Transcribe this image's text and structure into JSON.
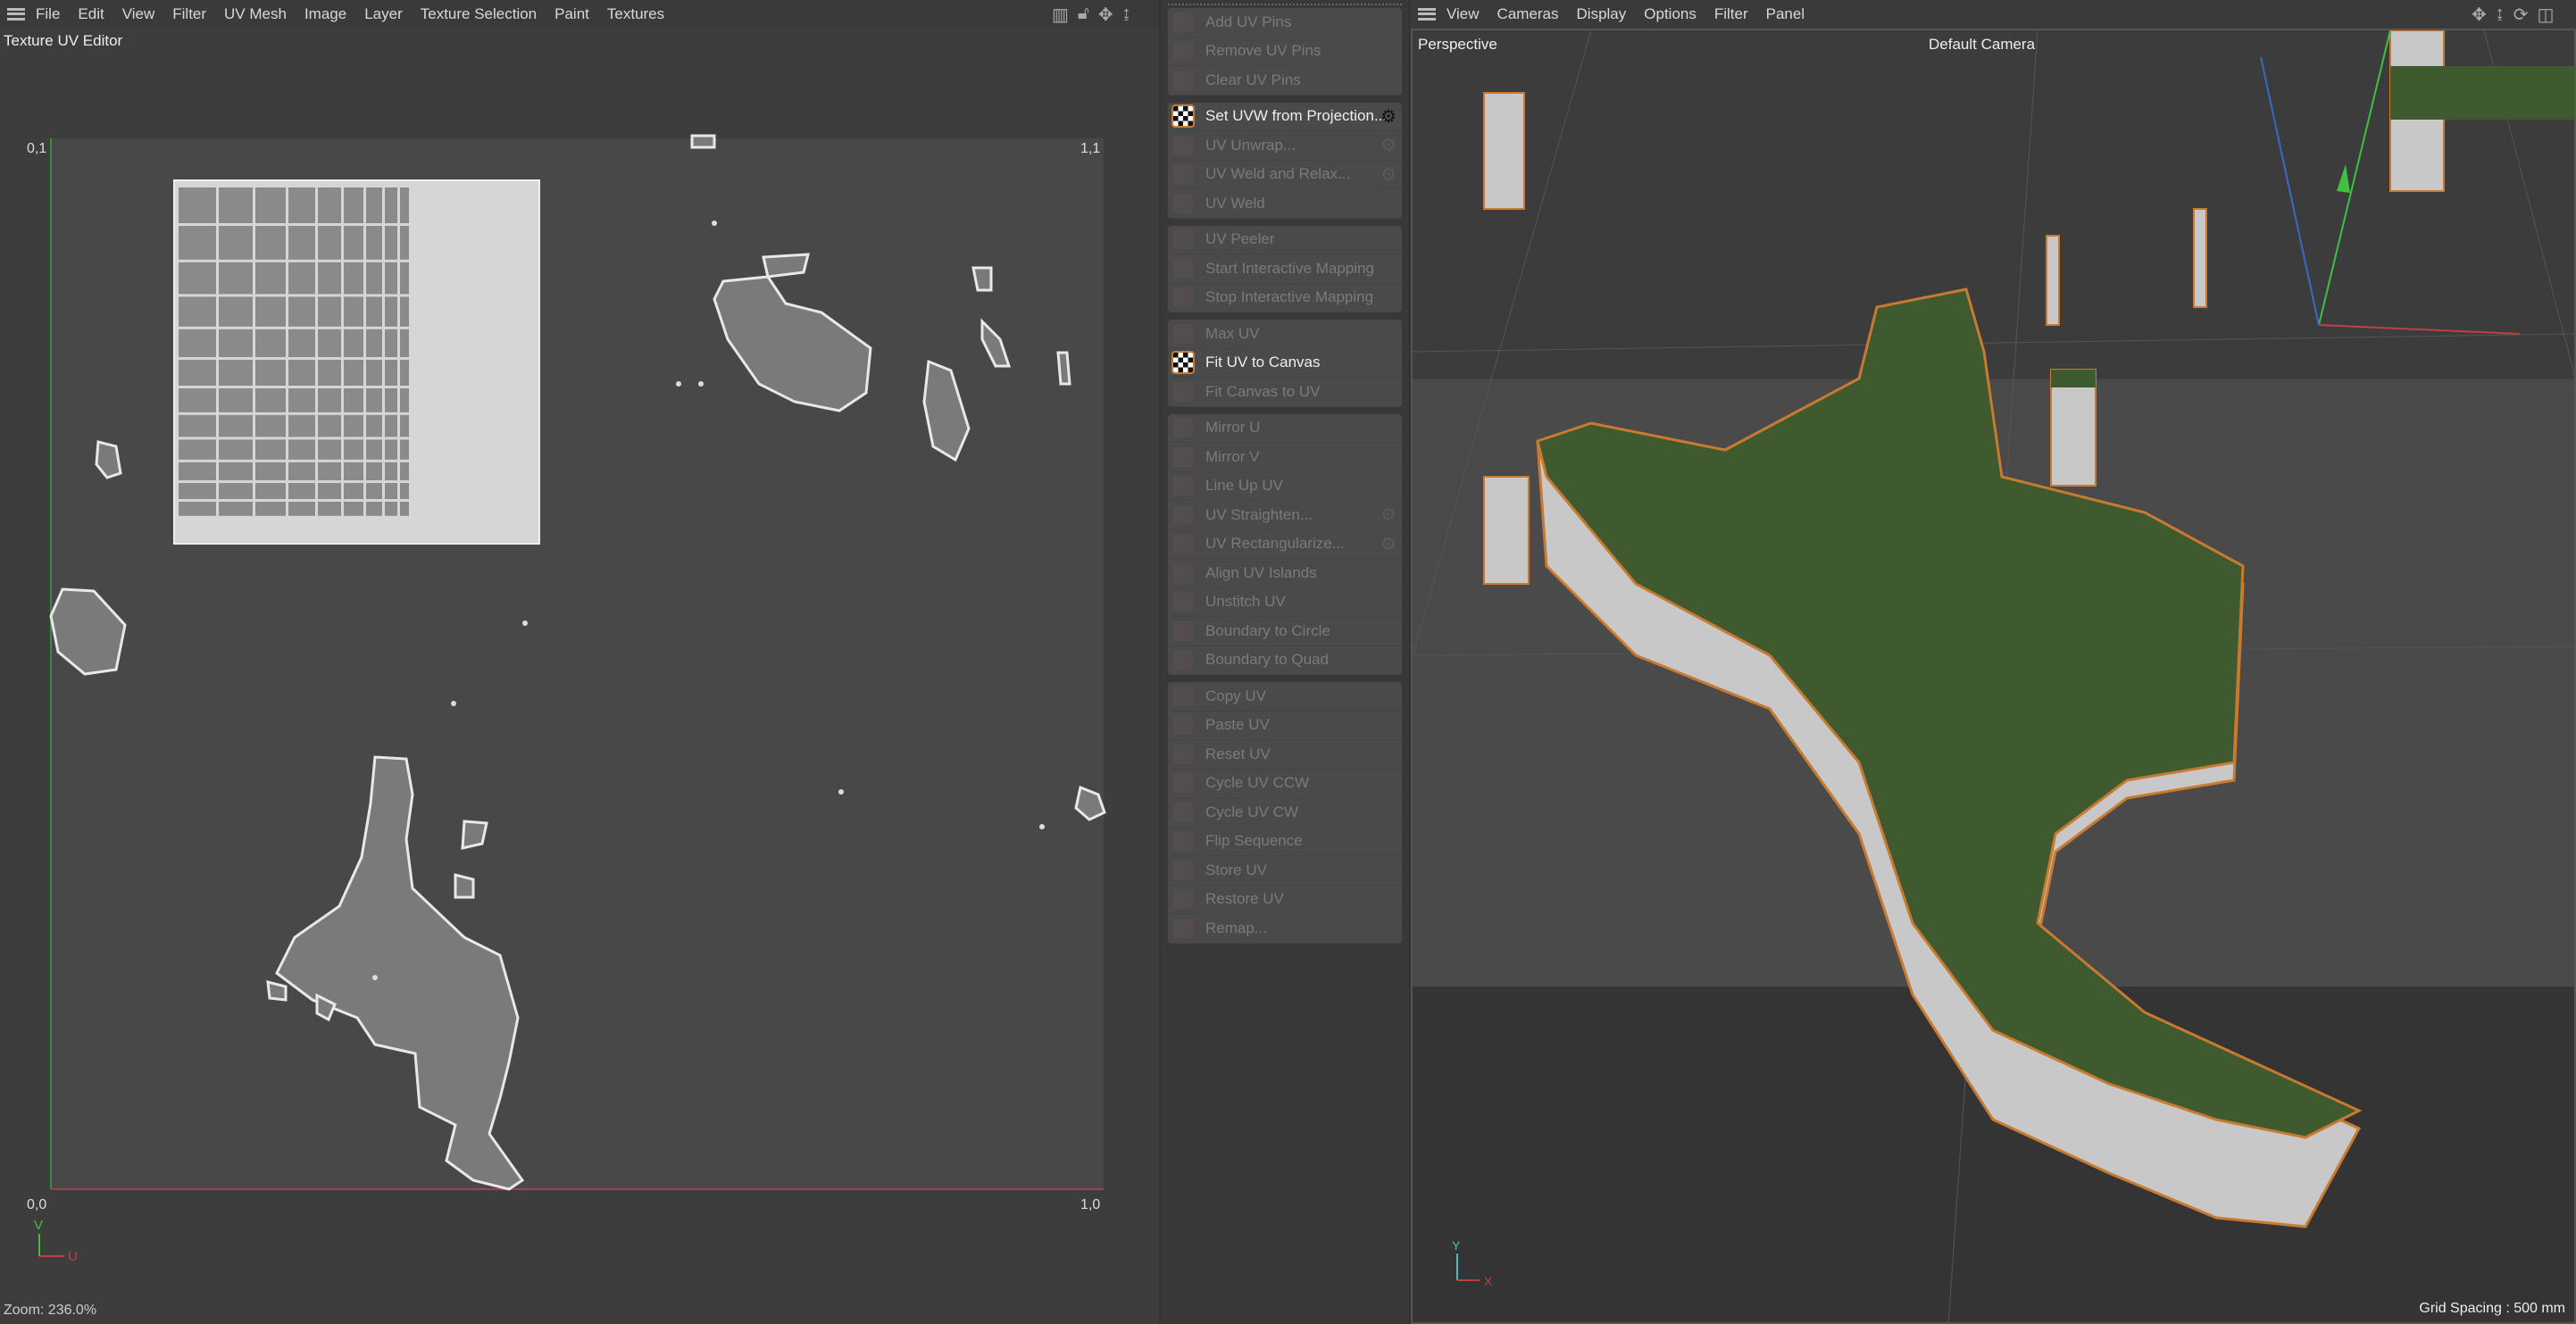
{
  "uv_editor": {
    "menu": [
      "File",
      "Edit",
      "View",
      "Filter",
      "UV Mesh",
      "Image",
      "Layer",
      "Texture Selection",
      "Paint",
      "Textures"
    ],
    "title": "Texture UV Editor",
    "corner_labels": {
      "top_left": "0,1",
      "top_right": "1,1",
      "bottom_left": "0,0",
      "bottom_right": "1,0"
    },
    "axis_labels": {
      "v": "V",
      "u": "U"
    },
    "status": "Zoom: 236.0%",
    "header_icons": [
      "histogram-icon",
      "lock-icon",
      "move-icon",
      "zoom-icon"
    ]
  },
  "toolbar": {
    "groups": [
      [
        {
          "label": "Add UV Pins"
        },
        {
          "label": "Remove UV Pins"
        },
        {
          "label": "Clear UV Pins"
        }
      ],
      [
        {
          "label": "Set UVW from Projection...",
          "active": true,
          "gear": true
        },
        {
          "label": "UV Unwrap...",
          "gear": true
        },
        {
          "label": "UV Weld and Relax...",
          "gear": true
        },
        {
          "label": "UV Weld"
        }
      ],
      [
        {
          "label": "UV Peeler"
        },
        {
          "label": "Start Interactive Mapping"
        },
        {
          "label": "Stop Interactive Mapping"
        }
      ],
      [
        {
          "label": "Max UV"
        },
        {
          "label": "Fit UV to Canvas",
          "active": true
        },
        {
          "label": "Fit Canvas to UV"
        }
      ],
      [
        {
          "label": "Mirror U"
        },
        {
          "label": "Mirror V"
        },
        {
          "label": "Line Up UV"
        },
        {
          "label": "UV Straighten...",
          "gear": true
        },
        {
          "label": "UV Rectangularize...",
          "gear": true
        },
        {
          "label": "Align UV Islands"
        },
        {
          "label": "Unstitch UV"
        },
        {
          "label": "Boundary to Circle"
        },
        {
          "label": "Boundary to Quad"
        }
      ],
      [
        {
          "label": "Copy UV"
        },
        {
          "label": "Paste UV"
        },
        {
          "label": "Reset UV"
        },
        {
          "label": "Cycle UV CCW"
        },
        {
          "label": "Cycle UV CW"
        },
        {
          "label": "Flip Sequence"
        },
        {
          "label": "Store UV"
        },
        {
          "label": "Restore UV"
        },
        {
          "label": "Remap..."
        }
      ]
    ]
  },
  "viewport": {
    "menu": [
      "View",
      "Cameras",
      "Display",
      "Options",
      "Filter",
      "Panel"
    ],
    "view_name": "Perspective",
    "camera": "Default Camera",
    "grid_spacing": "Grid Spacing : 500 mm",
    "axis_labels": {
      "y": "Y",
      "x": "X"
    },
    "header_icons": [
      "move-icon",
      "zoom-icon",
      "rotate-icon",
      "maximize-icon"
    ]
  },
  "colors": {
    "accent": "#c87a30",
    "terrain": "#3f5a2e",
    "uv_island": "#7a7a7a",
    "u_axis": "#c04050",
    "v_axis": "#40c040"
  }
}
